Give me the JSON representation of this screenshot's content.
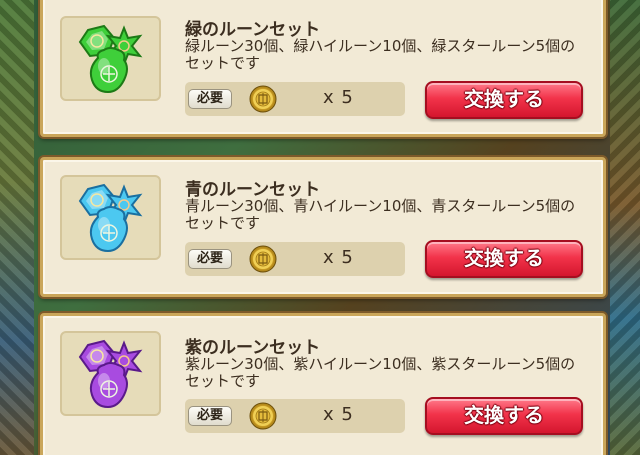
{
  "items": [
    {
      "title": "緑のルーンセット",
      "desc": "緑ルーン30個、緑ハイルーン10個、緑スタールーン5個のセットです",
      "need_label": "必要",
      "quantity": "x 5",
      "button_label": "交換する",
      "icon": "green-rune-set-icon",
      "gem_color": "#3fcf3a",
      "gem_dark": "#1d7a16"
    },
    {
      "title": "青のルーンセット",
      "desc": "青ルーン30個、青ハイルーン10個、青スタールーン5個のセットです",
      "need_label": "必要",
      "quantity": "x 5",
      "button_label": "交換する",
      "icon": "blue-rune-set-icon",
      "gem_color": "#4cc8f0",
      "gem_dark": "#1a6fa0"
    },
    {
      "title": "紫のルーンセット",
      "desc": "紫ルーン30個、紫ハイルーン10個、紫スタールーン5個のセットです",
      "need_label": "必要",
      "quantity": "x 5",
      "button_label": "交換する",
      "icon": "purple-rune-set-icon",
      "gem_color": "#a84be0",
      "gem_dark": "#5a1a8a"
    }
  ],
  "cost_icon": "gold-medal-icon",
  "colors": {
    "button": "#e8243c",
    "panel": "#f2ead6",
    "border": "#caa65a"
  }
}
